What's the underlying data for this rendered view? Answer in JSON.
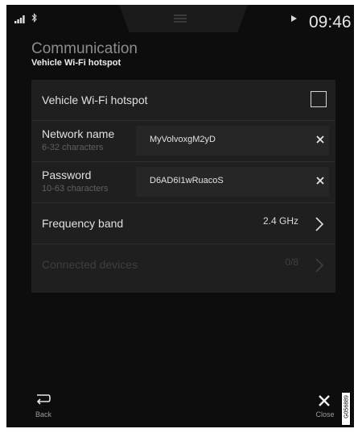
{
  "status_bar": {
    "time": "09:46"
  },
  "header": {
    "category": "Communication",
    "title": "Vehicle Wi-Fi hotspot"
  },
  "rows": {
    "hotspot": {
      "label": "Vehicle Wi-Fi hotspot",
      "checked": false
    },
    "network_name": {
      "label": "Network name",
      "hint": "6-32 characters",
      "value": "MyVolvoxgM2yD"
    },
    "password": {
      "label": "Password",
      "hint": "10-63 characters",
      "value": "D6AD6I1wRuacoS"
    },
    "frequency": {
      "label": "Frequency band",
      "value": "2.4 GHz"
    },
    "connected": {
      "label": "Connected devices",
      "value": "0/8",
      "disabled": true
    }
  },
  "bottom_bar": {
    "back_label": "Back",
    "close_label": "Close"
  },
  "image_code": "G056889"
}
